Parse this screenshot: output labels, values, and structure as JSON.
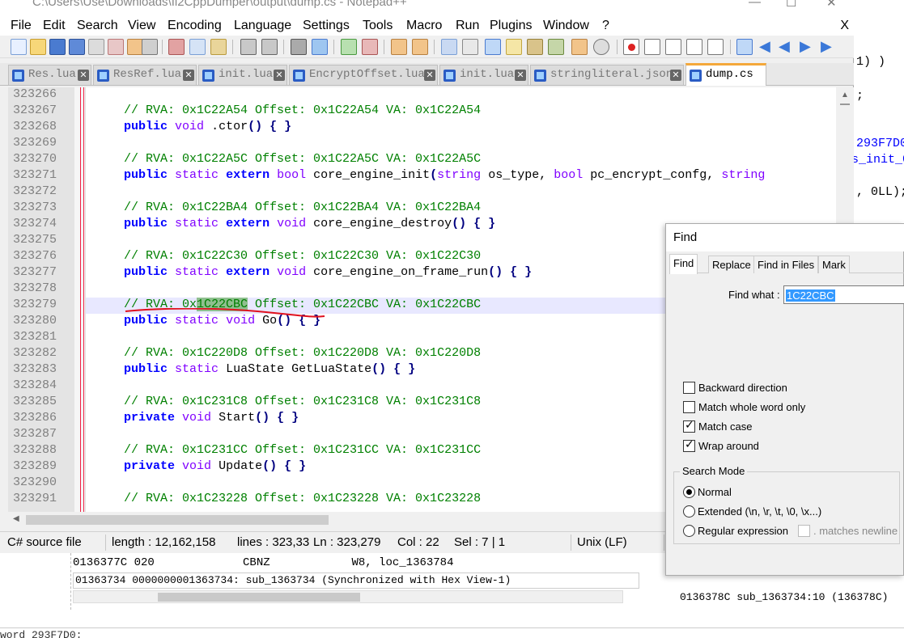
{
  "window": {
    "title": "C:\\Users\\Use\\Downloads\\Il2CppDumper\\output\\dump.cs - Notepad++",
    "minimize": "—",
    "maximize": "☐",
    "close": "✕"
  },
  "menu": {
    "items": [
      "File",
      "Edit",
      "Search",
      "View",
      "Encoding",
      "Language",
      "Settings",
      "Tools",
      "Macro",
      "Run",
      "Plugins",
      "Window",
      "?"
    ],
    "close": "X"
  },
  "tabs": [
    {
      "label": "Res.lua",
      "active": false
    },
    {
      "label": "ResRef.lua",
      "active": false
    },
    {
      "label": "init.lua",
      "active": false
    },
    {
      "label": "EncryptOffset.lua",
      "active": false
    },
    {
      "label": "init.lua",
      "active": false
    },
    {
      "label": "stringliteral.json",
      "active": false
    },
    {
      "label": "dump.cs",
      "active": true
    }
  ],
  "editor": {
    "line_numbers": [
      "323266",
      "323267",
      "323268",
      "323269",
      "323270",
      "323271",
      "323272",
      "323273",
      "323274",
      "323275",
      "323276",
      "323277",
      "323278",
      "323279",
      "323280",
      "323281",
      "323282",
      "323283",
      "323284",
      "323285",
      "323286",
      "323287",
      "323288",
      "323289",
      "323290",
      "323291"
    ],
    "lines": {
      "l1_comment": "// RVA: 0x1C22A54 Offset: 0x1C22A54 VA: 0x1C22A54",
      "l2_kw1": "public",
      "l2_t1": "void",
      "l2_rest": ".ctor",
      "l2_op": "() { }",
      "l4_comment": "// RVA: 0x1C22A5C Offset: 0x1C22A5C VA: 0x1C22A5C",
      "l5_kw1": "public",
      "l5_kw2": "static",
      "l5_kw3": "extern",
      "l5_t1": "bool",
      "l5_name": "core_engine_init",
      "l5_op1": "(",
      "l5_t2": "string",
      "l5_p1": "os_type,",
      "l5_t3": "bool",
      "l5_p2": "pc_encrypt_confg,",
      "l5_t4": "string",
      "l7_comment": "// RVA: 0x1C22BA4 Offset: 0x1C22BA4 VA: 0x1C22BA4",
      "l8_kw1": "public",
      "l8_kw2": "static",
      "l8_kw3": "extern",
      "l8_t1": "void",
      "l8_name": "core_engine_destroy",
      "l8_op": "() { }",
      "l10_comment": "// RVA: 0x1C22C30 Offset: 0x1C22C30 VA: 0x1C22C30",
      "l11_kw1": "public",
      "l11_kw2": "static",
      "l11_kw3": "extern",
      "l11_t1": "void",
      "l11_name": "core_engine_on_frame_run",
      "l11_op": "() { }",
      "l13_comment_a": "// RVA: 0x",
      "l13_hl": "1C22CBC",
      "l13_comment_b": " Offset: 0x1C22CBC VA: 0x1C22CBC",
      "l14_kw1": "public",
      "l14_kw2": "static",
      "l14_t1": "void",
      "l14_name": "Go",
      "l14_op": "() { }",
      "l16_comment": "// RVA: 0x1C220D8 Offset: 0x1C220D8 VA: 0x1C220D8",
      "l17_kw1": "public",
      "l17_kw2": "static",
      "l17_name": "LuaState GetLuaState",
      "l17_op": "() { }",
      "l19_comment": "// RVA: 0x1C231C8 Offset: 0x1C231C8 VA: 0x1C231C8",
      "l20_kw1": "private",
      "l20_t1": "void",
      "l20_name": "Start",
      "l20_op": "() { }",
      "l22_comment": "// RVA: 0x1C231CC Offset: 0x1C231CC VA: 0x1C231CC",
      "l23_kw1": "private",
      "l23_t1": "void",
      "l23_name": "Update",
      "l23_op": "() { }",
      "l25_comment": "// RVA: 0x1C23228 Offset: 0x1C23228 VA: 0x1C23228"
    }
  },
  "status": {
    "language": "C# source file",
    "length": "length : 12,162,158",
    "lines": "lines : 323,33",
    "ln": "Ln : 323,279",
    "col": "Col : 22",
    "sel": "Sel : 7 | 1",
    "eol": "Unix (LF)"
  },
  "find_dialog": {
    "title": "Find",
    "tabs": [
      "Find",
      "Replace",
      "Find in Files",
      "Mark"
    ],
    "find_what_label": "Find what :",
    "find_what_value": "1C22CBC",
    "options": [
      {
        "label": "Backward direction",
        "checked": false
      },
      {
        "label": "Match whole word only",
        "checked": false
      },
      {
        "label": "Match case",
        "checked": true
      },
      {
        "label": "Wrap around",
        "checked": true
      }
    ],
    "search_mode_label": "Search Mode",
    "modes": [
      {
        "label": "Normal",
        "checked": true
      },
      {
        "label": "Extended (\\n, \\r, \\t, \\0, \\x...)",
        "checked": false
      },
      {
        "label": "Regular expression",
        "checked": false
      }
    ],
    "matches_newline": ". matches newline"
  },
  "background": {
    "bg_line1": "1) )",
    "bg_line2": ";",
    "bg_line3": "293F7D0",
    "bg_line4": "s_init_0",
    "bg_line5": ", 0LL);",
    "ida_asm": "0136377C 020             CBNZ            W8, loc_1363784",
    "ida_sync": "01363734 0000000001363734: sub_1363734 (Synchronized with Hex View-1)",
    "ida_addr": "0136378C sub_1363734:10 (136378C)",
    "ida_bottom": "word 293F7D0:"
  },
  "colors": {
    "comment": "#008000",
    "keyword": "#0000ff",
    "type": "#8000ff",
    "highlight": "#8fbf8f",
    "current_line": "#e8e8ff",
    "active_tab_accent": "#f4a83a"
  }
}
